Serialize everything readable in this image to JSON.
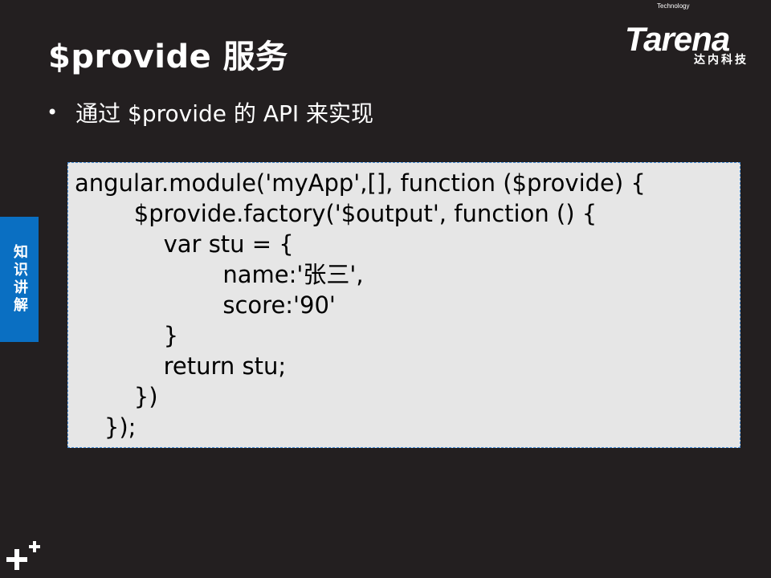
{
  "slide": {
    "title": "$provide 服务",
    "bullet": "通过 $provide 的 API 来实现",
    "side_tab": "知识讲解"
  },
  "logo": {
    "small_text": "Technology",
    "main_text": "Tarena",
    "sub_text": "达内科技"
  },
  "code": {
    "lines": [
      "angular.module('myApp',[], function ($provide) {",
      "        $provide.factory('$output', function () {",
      "            var stu = {",
      "                    name:'张三',",
      "                    score:'90'",
      "            }",
      "            return stu;",
      "        })",
      "    });"
    ]
  },
  "colors": {
    "background": "#231f20",
    "side_tab": "#0a6fc2",
    "code_box": "#e6e6e6",
    "code_border": "#4a90d9"
  },
  "icons": {
    "bottom_left": "plus-plus-icon"
  }
}
